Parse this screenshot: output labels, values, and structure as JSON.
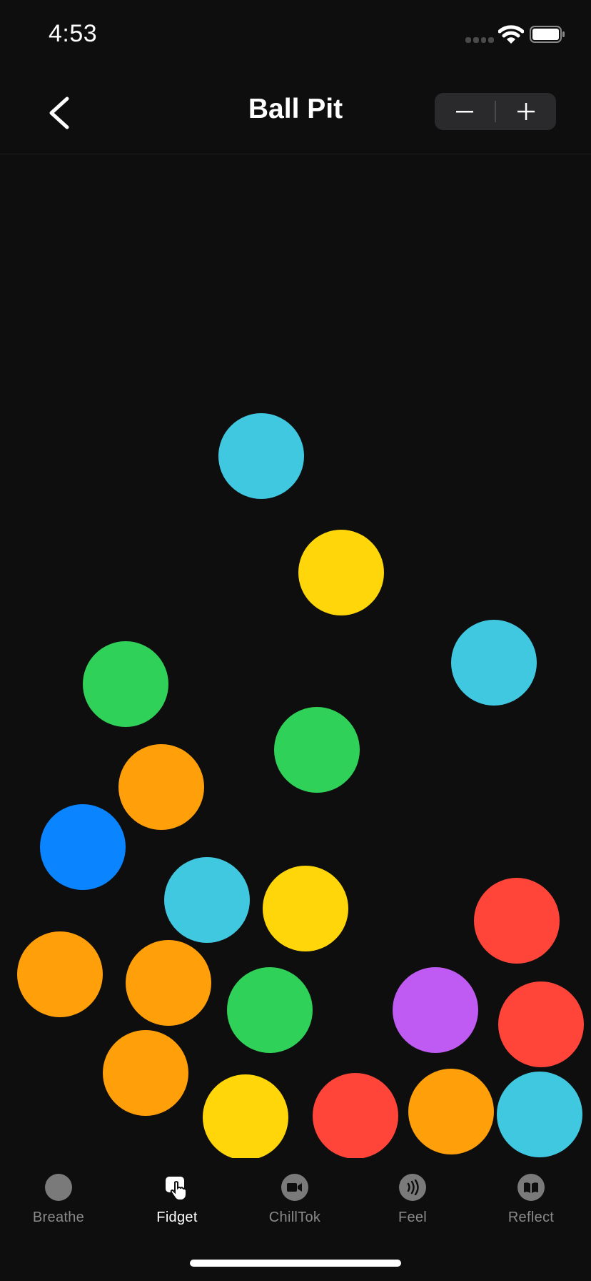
{
  "status_bar": {
    "time": "4:53"
  },
  "header": {
    "title": "Ball Pit",
    "decrease_label": "−",
    "increase_label": "+"
  },
  "balls": [
    {
      "color": "#40c8e0"
    },
    {
      "color": "#ffd60a"
    },
    {
      "color": "#40c8e0"
    },
    {
      "color": "#30d158"
    },
    {
      "color": "#30d158"
    },
    {
      "color": "#ff9f0a"
    },
    {
      "color": "#0a84ff"
    },
    {
      "color": "#40c8e0"
    },
    {
      "color": "#ffd60a"
    },
    {
      "color": "#ff453a"
    },
    {
      "color": "#ff9f0a"
    },
    {
      "color": "#ff9f0a"
    },
    {
      "color": "#30d158"
    },
    {
      "color": "#bf5af2"
    },
    {
      "color": "#ff453a"
    },
    {
      "color": "#ff9f0a"
    },
    {
      "color": "#ffd60a"
    },
    {
      "color": "#ff453a"
    },
    {
      "color": "#ff9f0a"
    },
    {
      "color": "#40c8e0"
    }
  ],
  "tabs": [
    {
      "label": "Breathe",
      "icon": "circle-icon"
    },
    {
      "label": "Fidget",
      "icon": "hand-tap-icon",
      "active": true
    },
    {
      "label": "ChillTok",
      "icon": "video-icon"
    },
    {
      "label": "Feel",
      "icon": "sound-waves-icon"
    },
    {
      "label": "Reflect",
      "icon": "book-icon"
    }
  ]
}
